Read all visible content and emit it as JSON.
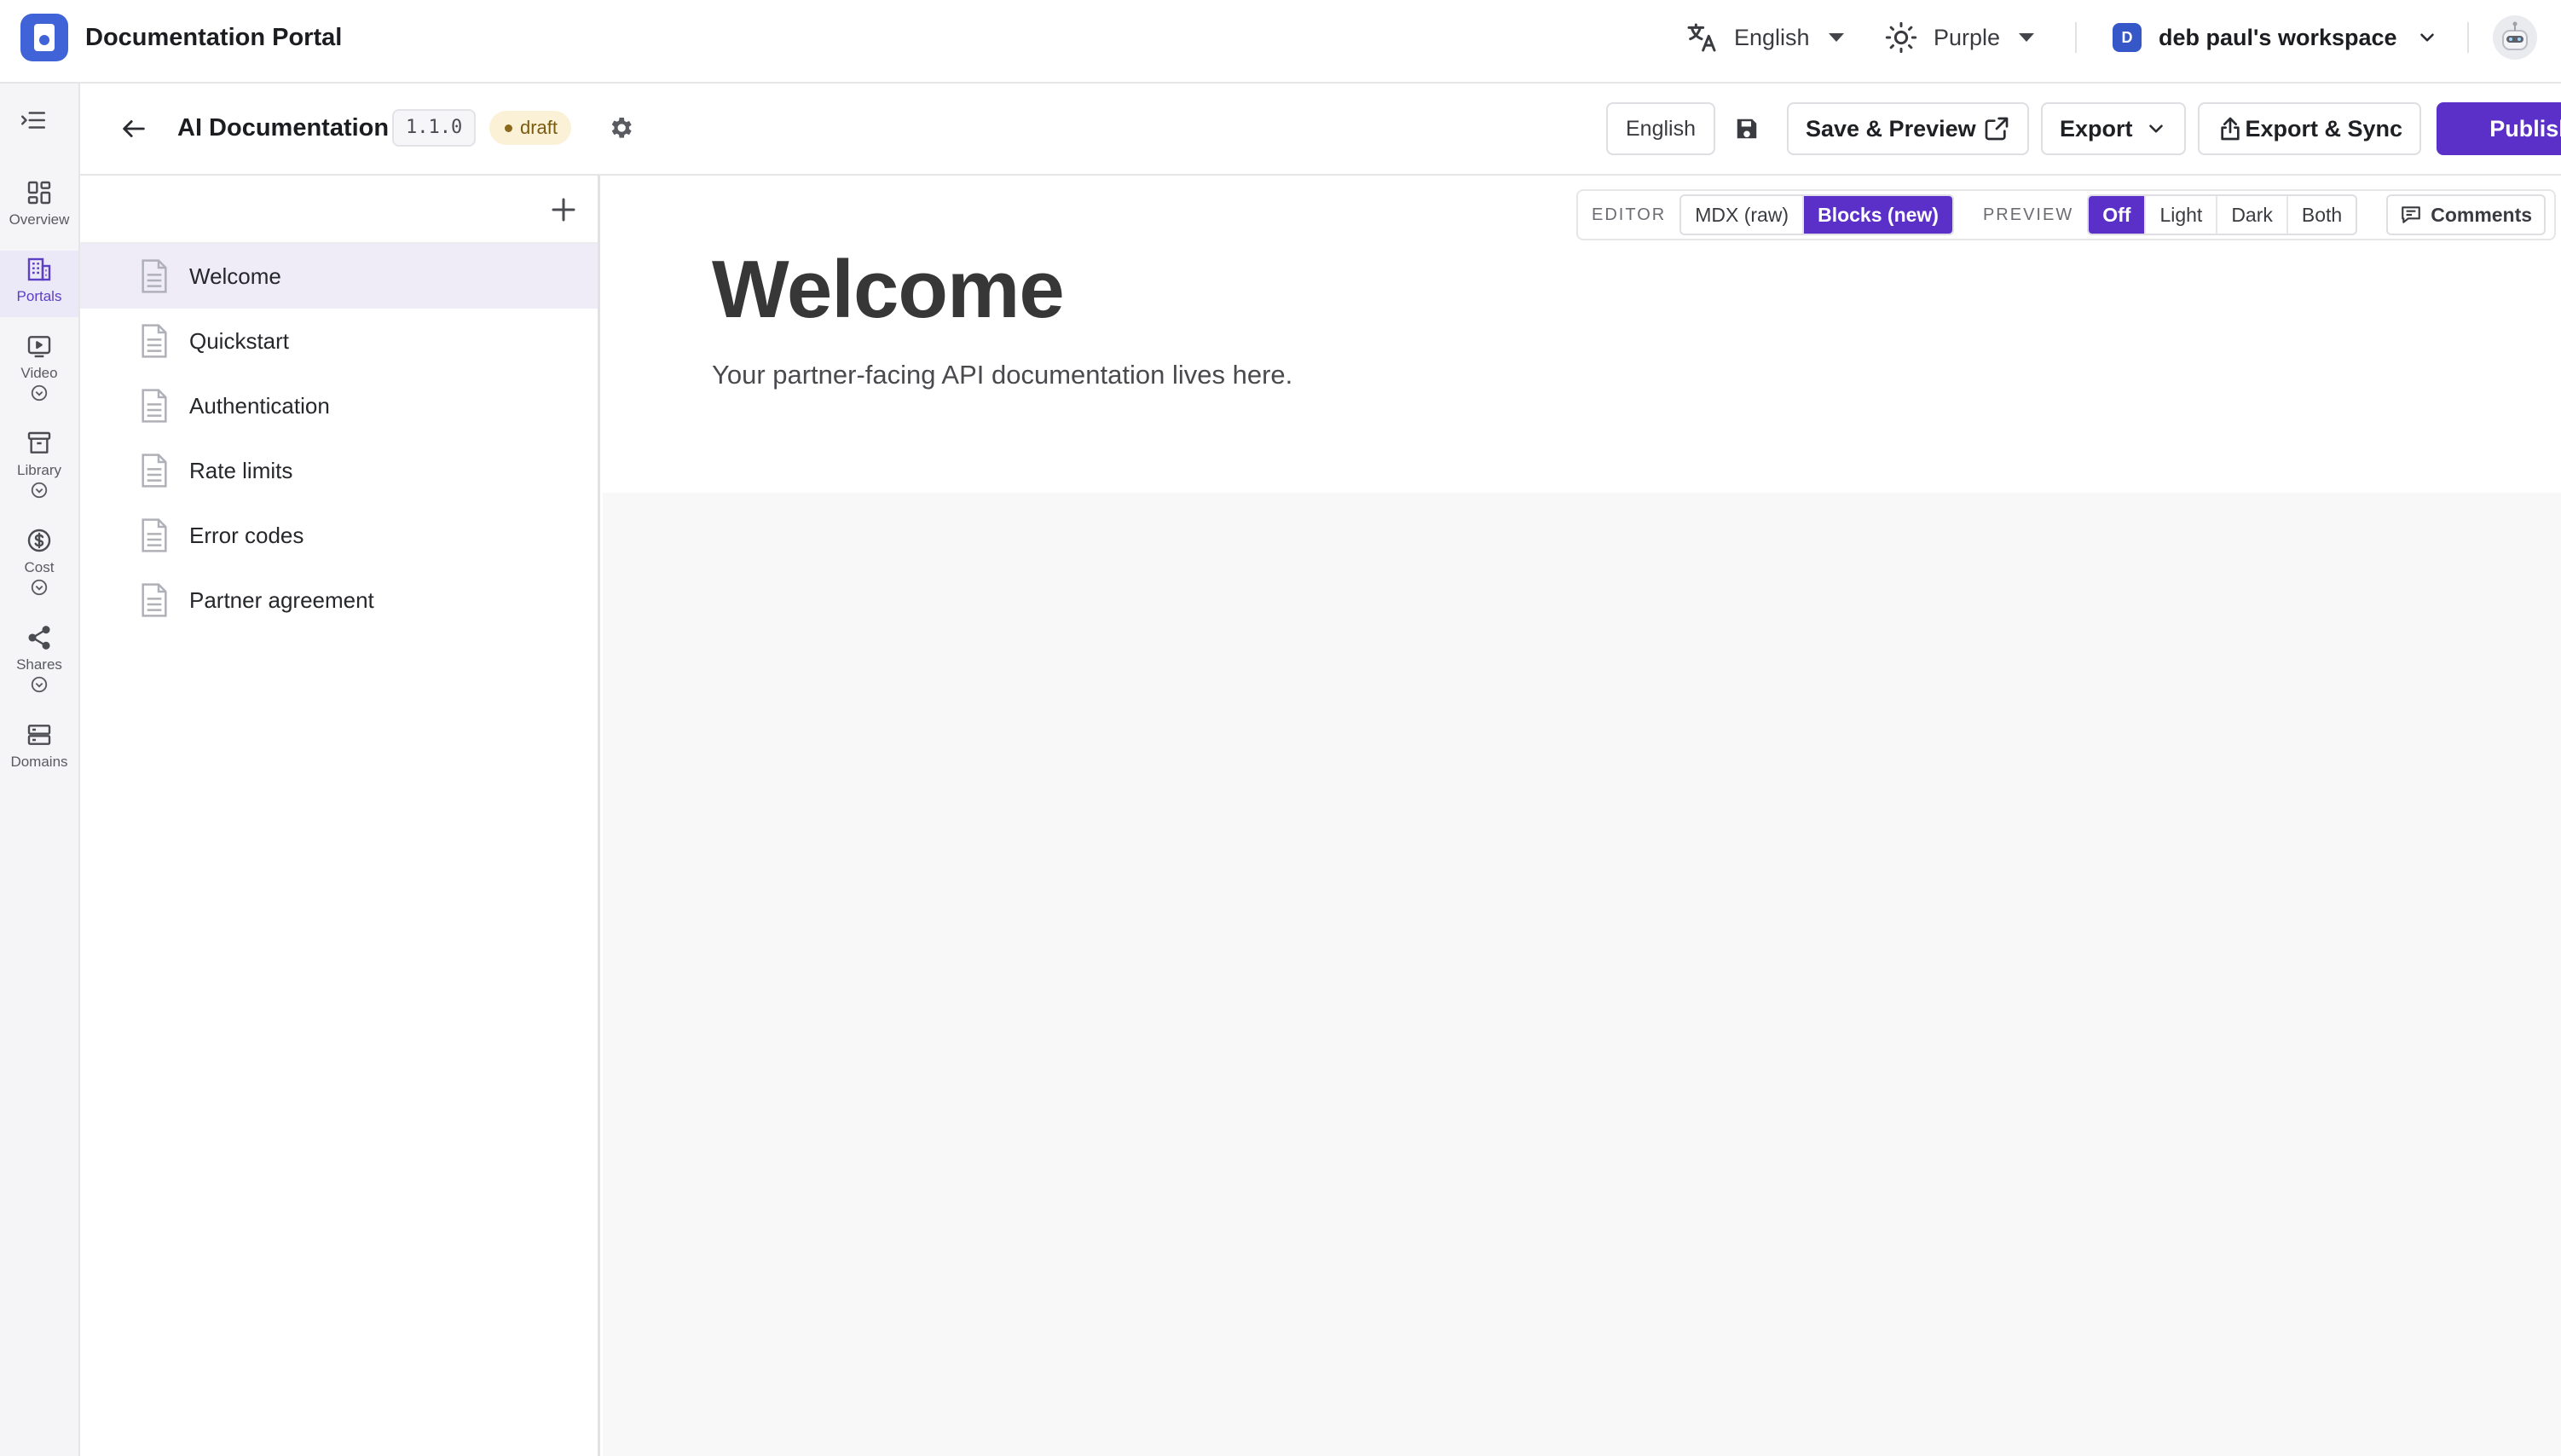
{
  "app": {
    "title": "Documentation Portal"
  },
  "topbar": {
    "language": "English",
    "theme": "Purple",
    "workspace": {
      "badge": "D",
      "name": "deb paul's workspace"
    }
  },
  "rail": {
    "items": [
      {
        "label": "Overview",
        "icon": "grid-icon"
      },
      {
        "label": "Portals",
        "icon": "building-icon",
        "active": true
      },
      {
        "label": "Video",
        "icon": "play-icon"
      },
      {
        "label": "Library",
        "icon": "archive-icon"
      },
      {
        "label": "Cost",
        "icon": "dollar-icon"
      },
      {
        "label": "Shares",
        "icon": "share-icon"
      },
      {
        "label": "Domains",
        "icon": "server-icon"
      }
    ]
  },
  "doc": {
    "title": "AI Documentation",
    "version": "1.1.0",
    "status": "draft"
  },
  "toolbar": {
    "language": "English",
    "save_preview": "Save & Preview",
    "export": "Export",
    "export_sync": "Export & Sync",
    "publish": "Publish"
  },
  "pages": [
    {
      "label": "Welcome",
      "selected": true
    },
    {
      "label": "Quickstart"
    },
    {
      "label": "Authentication"
    },
    {
      "label": "Rate limits"
    },
    {
      "label": "Error codes"
    },
    {
      "label": "Partner agreement"
    }
  ],
  "modebar": {
    "editor_caption": "EDITOR",
    "editor_options": [
      "MDX (raw)",
      "Blocks (new)"
    ],
    "editor_selected": "Blocks (new)",
    "preview_caption": "PREVIEW",
    "preview_options": [
      "Off",
      "Light",
      "Dark",
      "Both"
    ],
    "preview_selected": "Off",
    "comments": "Comments"
  },
  "content": {
    "heading": "Welcome",
    "paragraph": "Your partner-facing API documentation lives here."
  },
  "colors": {
    "accent": "#5b30c9",
    "brand": "#4063d8",
    "draft_bg": "#fbf1d6"
  }
}
